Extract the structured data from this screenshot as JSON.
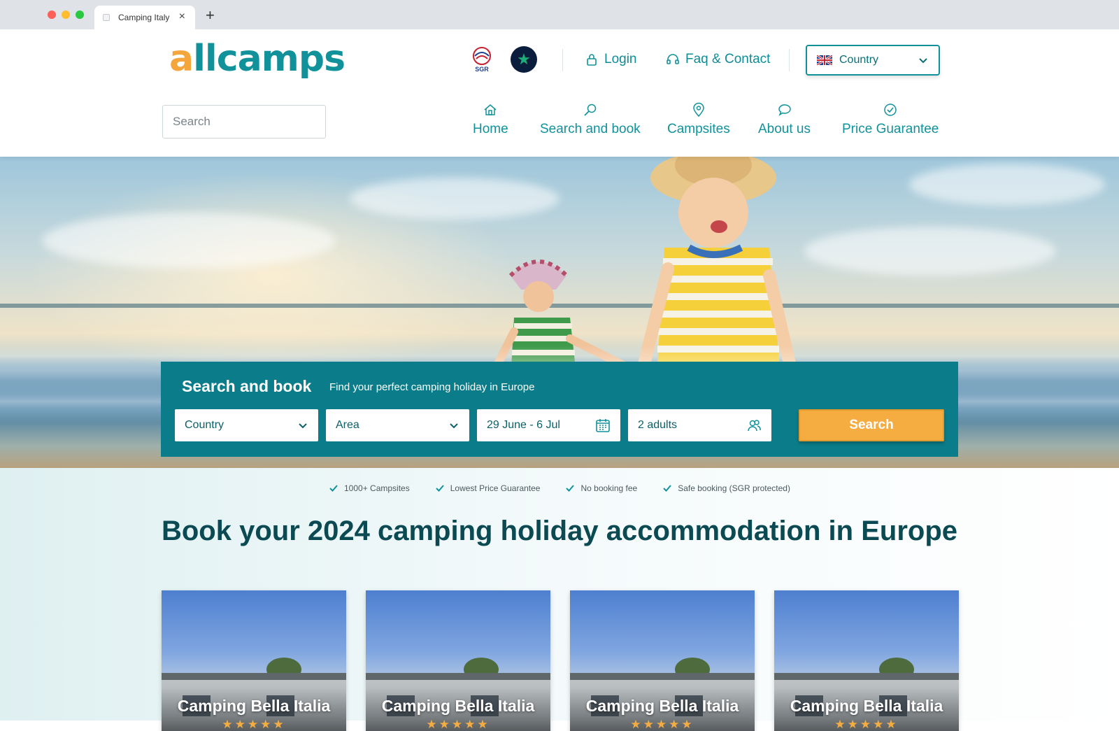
{
  "browser": {
    "tab_title": "Camping Italy",
    "tab_close": "×",
    "new_tab": "+"
  },
  "header": {
    "logo_first": "a",
    "logo_rest": "llcamps",
    "sgr_label": "SGR",
    "login": "Login",
    "faq": "Faq & Contact",
    "country": "Country",
    "search_placeholder": "Search",
    "nav": [
      {
        "label": "Home",
        "icon": "home-icon"
      },
      {
        "label": "Search and book",
        "icon": "magnifier-icon"
      },
      {
        "label": "Campsites",
        "icon": "map-pin-icon"
      },
      {
        "label": "About us",
        "icon": "chat-bubble-icon"
      },
      {
        "label": "Price Guarantee",
        "icon": "check-circle-icon"
      }
    ]
  },
  "booking": {
    "title": "Search and book",
    "subtitle": "Find your perfect camping holiday in Europe",
    "country": "Country",
    "area": "Area",
    "dates": "29 June - 6 Jul",
    "guests": "2 adults",
    "search_button": "Search"
  },
  "usps": [
    "1000+ Campsites",
    "Lowest Price Guarantee",
    "No booking fee",
    "Safe booking (SGR protected)"
  ],
  "headline": "Book your 2024 camping holiday accommodation in Europe",
  "cards": [
    {
      "name": "Camping Bella Italia",
      "stars": "★★★★★"
    },
    {
      "name": "Camping Bella Italia",
      "stars": "★★★★★"
    },
    {
      "name": "Camping Bella Italia",
      "stars": "★★★★★"
    },
    {
      "name": "Camping Bella Italia",
      "stars": "★★★★★"
    }
  ],
  "colors": {
    "brand_teal": "#11929b",
    "booking_bg": "#0b7d8a",
    "accent_orange": "#f5ad42",
    "headline": "#0b4a52"
  }
}
